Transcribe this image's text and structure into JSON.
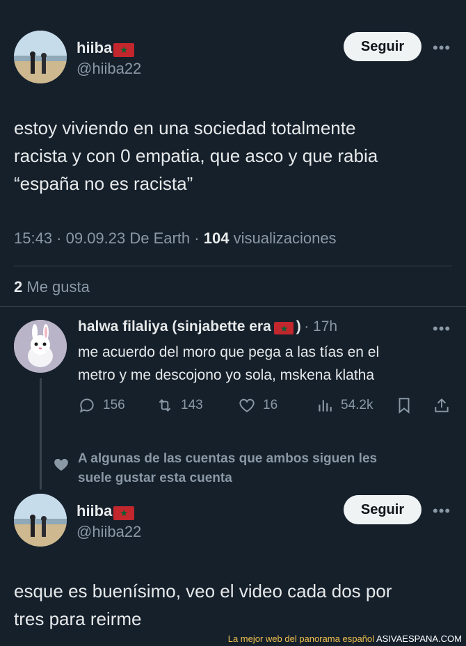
{
  "tweet": {
    "author_name": "hiiba",
    "author_handle": "@hiiba22",
    "follow_label": "Seguir",
    "more_label": "•••",
    "text_line1": "estoy viviendo en una sociedad totalmente",
    "text_line2": "racista y con 0 empatia, que asco y que rabia",
    "text_line3": "“españa no es racista”",
    "time": "15:43 · 09.09.23 De Earth ·",
    "views_count": "104",
    "views_label": "visualizaciones",
    "likes_count": "2",
    "likes_label": "Me gusta"
  },
  "reply": {
    "author_name": "halwa filaliya (sinjabette era",
    "name_suffix": ")",
    "time": "· 17h",
    "more_label": "•••",
    "text_line1": "me acuerdo del moro que pega a las tías en el",
    "text_line2": "metro y me descojono yo sola, mskena klatha",
    "replies": "156",
    "retweets": "143",
    "likes": "16",
    "views": "54.2k"
  },
  "social_context": {
    "line1": "A algunas de las cuentas que ambos siguen les",
    "line2": "suele gustar esta cuenta"
  },
  "tweet2": {
    "author_name": "hiiba",
    "author_handle": "@hiiba22",
    "follow_label": "Seguir",
    "more_label": "•••",
    "text_line1": "esque es buenísimo, veo el video cada dos por",
    "text_line2": "tres para reirme"
  },
  "footer": {
    "tagline": "La mejor web del panorama español",
    "site": "ASIVAESPANA.COM"
  },
  "colors": {
    "background": "#15202b",
    "text": "#e7e9ea",
    "muted": "#8b98a5",
    "follow_button": "#eff3f4"
  }
}
